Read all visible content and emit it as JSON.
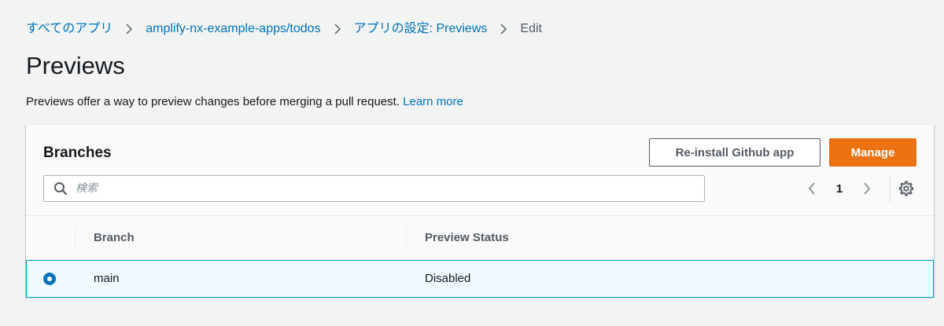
{
  "breadcrumb": {
    "items": [
      {
        "label": "すべてのアプリ"
      },
      {
        "label": "amplify-nx-example-apps/todos"
      },
      {
        "label": "アプリの設定: Previews"
      },
      {
        "label": "Edit"
      }
    ]
  },
  "page": {
    "title": "Previews",
    "description": "Previews offer a way to preview changes before merging a pull request.",
    "learn_more": "Learn more"
  },
  "panel": {
    "title": "Branches",
    "reinstall_label": "Re-install Github app",
    "manage_label": "Manage",
    "search_placeholder": "検索",
    "pagination": {
      "current_page": "1"
    }
  },
  "table": {
    "columns": [
      "Branch",
      "Preview Status"
    ],
    "rows": [
      {
        "branch": "main",
        "status": "Disabled",
        "selected": true
      }
    ]
  },
  "colors": {
    "link": "#0073bb",
    "primary_button": "#ec7211",
    "selected_row_bg": "#f1faff",
    "selected_row_border": "#00a1c9"
  },
  "icons": [
    "chevron-right-icon",
    "search-icon",
    "chevron-left-icon",
    "gear-icon",
    "radio-selected-icon"
  ]
}
